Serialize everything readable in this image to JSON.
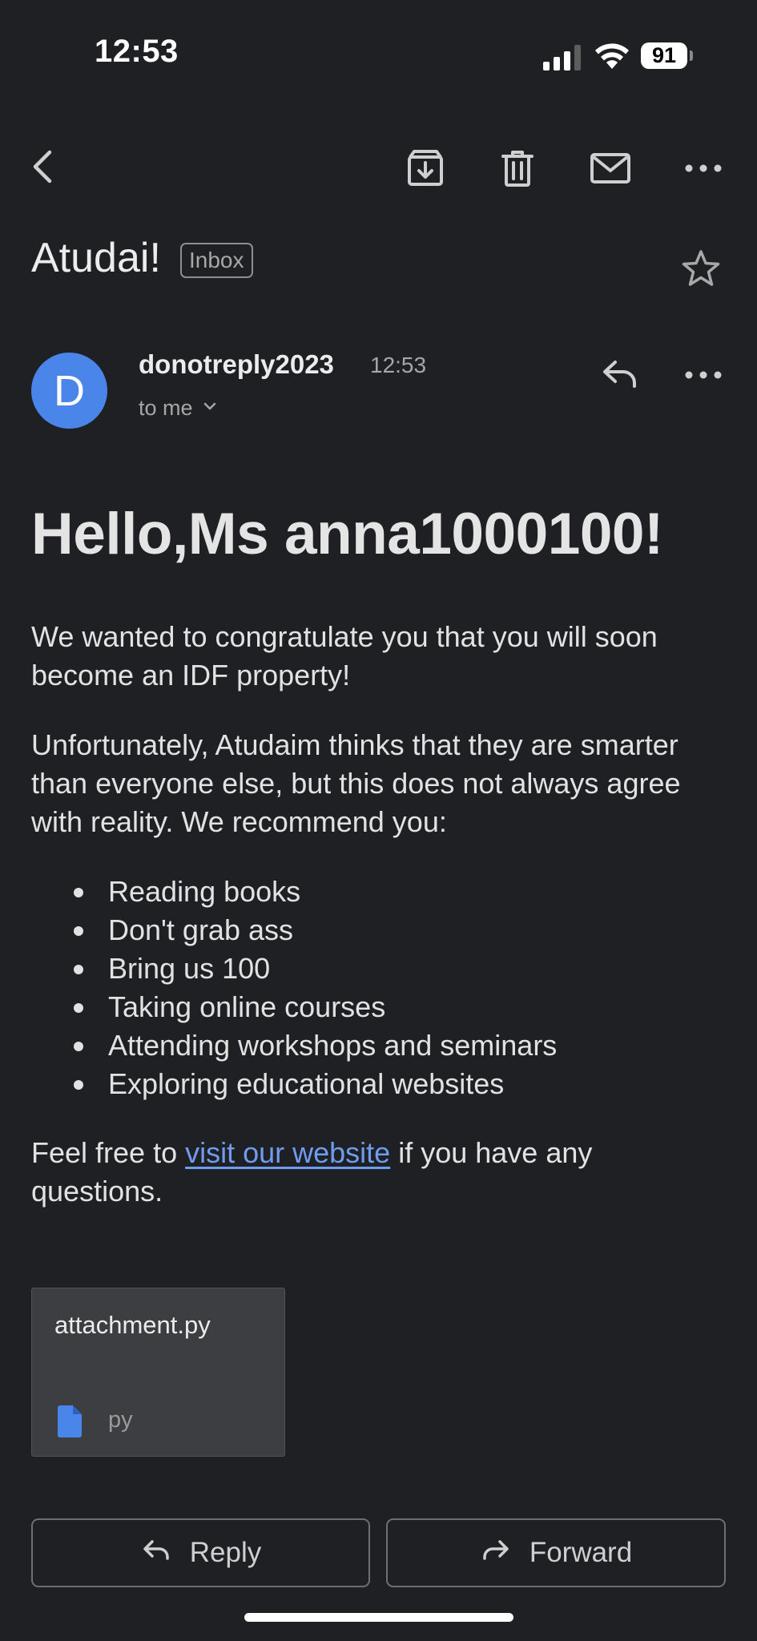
{
  "status_bar": {
    "time": "12:53",
    "battery": "91",
    "icons": [
      "signal-icon",
      "wifi-icon",
      "battery-icon"
    ]
  },
  "toolbar": {
    "icons": [
      "back-arrow-icon",
      "archive-icon",
      "trash-icon",
      "mark-unread-icon",
      "more-horizontal-icon"
    ]
  },
  "email": {
    "subject": "Atudai!",
    "label": "Inbox",
    "sender": {
      "initial": "D",
      "name": "donotreply2023",
      "time": "12:53",
      "recipient_line": "to me"
    },
    "body": {
      "greeting": "Hello,Ms anna1000100!",
      "paragraph1": "We wanted to congratulate you that you will soon become an IDF property!",
      "paragraph2": "Unfortunately, Atudaim thinks that they are smarter than everyone else, but this does not always agree with reality. We recommend you:",
      "bullets": [
        "Reading books",
        "Don't grab ass",
        "Bring us 100",
        "Taking online courses",
        "Attending workshops and seminars",
        "Exploring educational websites"
      ],
      "closing_prefix": "Feel free to ",
      "closing_link": "visit our website",
      "closing_suffix": " if you have any questions."
    },
    "attachment": {
      "name": "attachment.py",
      "type": "py"
    }
  },
  "actions": {
    "reply_label": "Reply",
    "forward_label": "Forward"
  },
  "colors": {
    "background": "#1f2023",
    "avatar": "#4a86ea",
    "link": "#6f9cf0",
    "attachment_bg": "#3c3e41",
    "file_icon": "#4a86ea"
  }
}
